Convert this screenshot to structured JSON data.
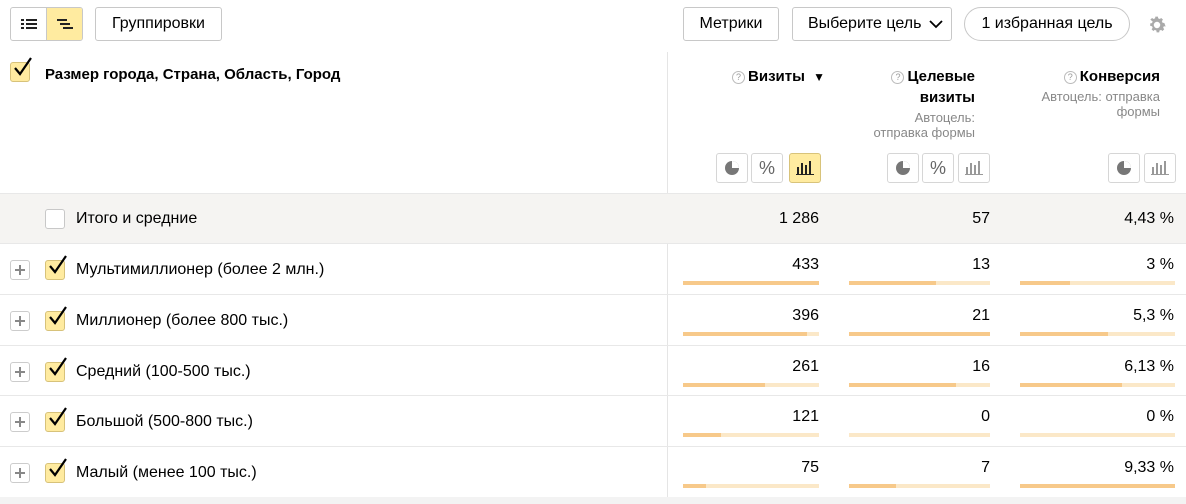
{
  "toolbar": {
    "groupings_label": "Группировки",
    "metrics_label": "Метрики",
    "goal_select_label": "Выберите цель",
    "favorite_goal_label": "1 избранная цель"
  },
  "header": {
    "dimension_title": "Размер города, Страна, Область, Город",
    "columns": [
      {
        "title": "Визиты",
        "sort": "▼",
        "subtitle": ""
      },
      {
        "title_line1": "Целевые",
        "title_line2": "визиты",
        "subtitle_line1": "Автоцель:",
        "subtitle_line2": "отправка формы"
      },
      {
        "title": "Конверсия",
        "subtitle_line1": "Автоцель: отправка",
        "subtitle_line2": "формы"
      }
    ]
  },
  "total": {
    "label": "Итого и средние",
    "visits": "1 286",
    "goal_visits": "57",
    "conversion": "4,43 %"
  },
  "rows": [
    {
      "label": "Мультимиллионер (более 2 млн.)",
      "visits": "433",
      "goal_visits": "13",
      "conversion": "3 %",
      "visits_share": 1.0,
      "goal_share": 0.62,
      "conv_share": 0.32
    },
    {
      "label": "Миллионер (более 800 тыс.)",
      "visits": "396",
      "goal_visits": "21",
      "conversion": "5,3 %",
      "visits_share": 0.91,
      "goal_share": 1.0,
      "conv_share": 0.57
    },
    {
      "label": "Средний (100-500 тыс.)",
      "visits": "261",
      "goal_visits": "16",
      "conversion": "6,13 %",
      "visits_share": 0.6,
      "goal_share": 0.76,
      "conv_share": 0.66
    },
    {
      "label": "Большой (500-800 тыс.)",
      "visits": "121",
      "goal_visits": "0",
      "conversion": "0 %",
      "visits_share": 0.28,
      "goal_share": 0.0,
      "conv_share": 0.0
    },
    {
      "label": "Малый (менее 100 тыс.)",
      "visits": "75",
      "goal_visits": "7",
      "conversion": "9,33 %",
      "visits_share": 0.17,
      "goal_share": 0.33,
      "conv_share": 1.0
    }
  ],
  "colors": {
    "accent": "#ffeba0",
    "bar_fill": "#f7c98a",
    "bar_bg": "#fbe8c8"
  }
}
